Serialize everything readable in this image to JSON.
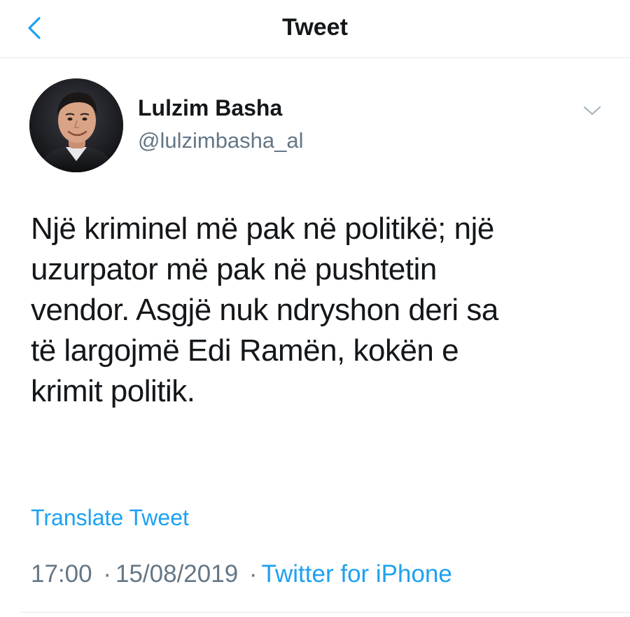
{
  "header": {
    "title": "Tweet",
    "back_icon": "chevron-left-icon"
  },
  "author": {
    "name": "Lulzim Basha",
    "handle": "@lulzimbasha_al",
    "avatar": "profile-photo",
    "more_icon": "chevron-down-icon"
  },
  "tweet": {
    "lines": [
      "Një kriminel më pak në politikë; një",
      "uzurpator më pak në pushtetin",
      "vendor. Asgjë nuk ndryshon deri sa",
      "të largojmë Edi Ramën, kokën e",
      "krimit politik."
    ],
    "translate_label": "Translate Tweet",
    "time": "17:00",
    "date": "15/08/2019",
    "separator": "·",
    "source": "Twitter for iPhone"
  },
  "colors": {
    "accent": "#1da1f2",
    "text": "#14171a",
    "secondary": "#657786",
    "divider": "#e1e8ed"
  }
}
